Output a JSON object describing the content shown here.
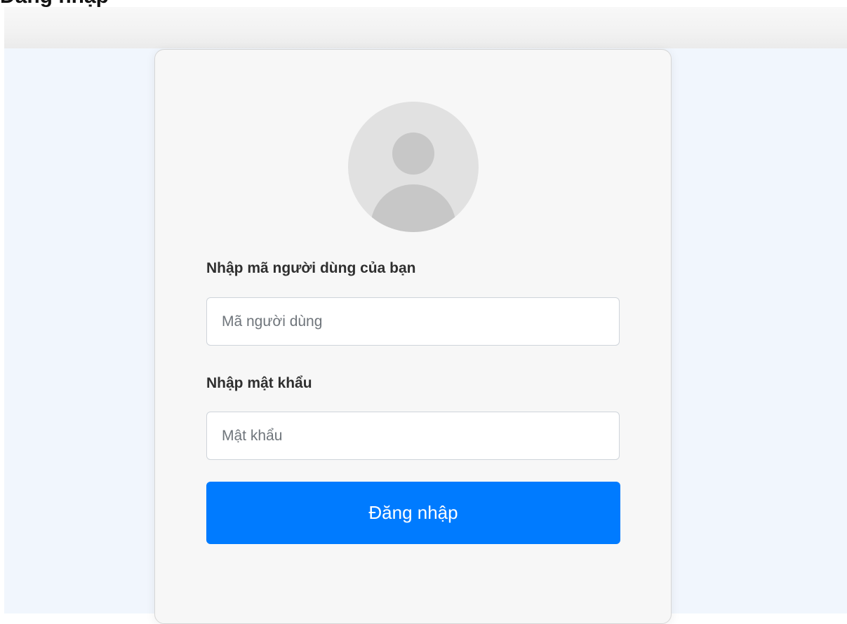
{
  "page": {
    "title": "Đăng nhập"
  },
  "login_form": {
    "username_label": "Nhập mã người dùng của bạn",
    "username_placeholder": "Mã người dùng",
    "username_value": "",
    "password_label": "Nhập mật khẩu",
    "password_placeholder": "Mật khẩu",
    "password_value": "",
    "submit_label": "Đăng nhập"
  },
  "icons": {
    "avatar": "user-avatar-icon"
  },
  "colors": {
    "primary": "#007bff",
    "page_background": "#f1f6fd",
    "card_background": "#f7f7f7",
    "avatar_background": "#e1e1e1",
    "avatar_foreground": "#c7c7c7"
  }
}
